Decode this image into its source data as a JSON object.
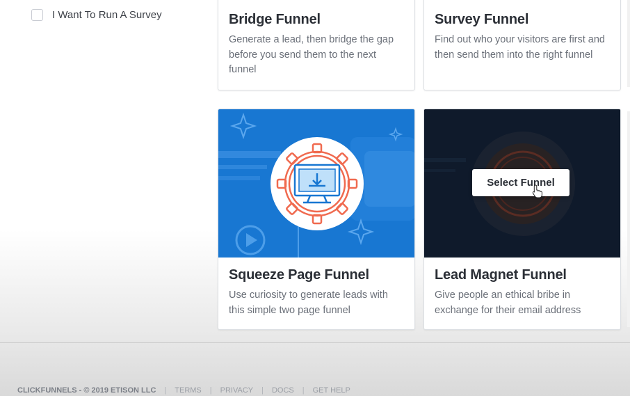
{
  "sidebar": {
    "filters": [
      {
        "label": "I Want To Run A Survey",
        "checked": false
      }
    ]
  },
  "funnels": [
    {
      "title": "Bridge Funnel",
      "description": "Generate a lead, then bridge the gap before you send them to the next funnel"
    },
    {
      "title": "Survey Funnel",
      "description": "Find out who your visitors are first and then send them into the right funnel"
    },
    {
      "title": "Squeeze Page Funnel",
      "description": "Use curiosity to generate leads with this simple two page funnel"
    },
    {
      "title": "Lead Magnet Funnel",
      "description": "Give people an ethical bribe in exchange for their email address",
      "hover_button": "Select Funnel"
    }
  ],
  "footer": {
    "brand": "CLICKFUNNELS - © 2019 ETISON LLC",
    "links": [
      "TERMS",
      "PRIVACY",
      "DOCS",
      "GET HELP"
    ]
  },
  "colors": {
    "accent": "#2c8be6",
    "squeeze_bg": "#1877d2",
    "lead_magnet_bg": "#0f1a2b",
    "icon_ring": "#f06a4f"
  }
}
